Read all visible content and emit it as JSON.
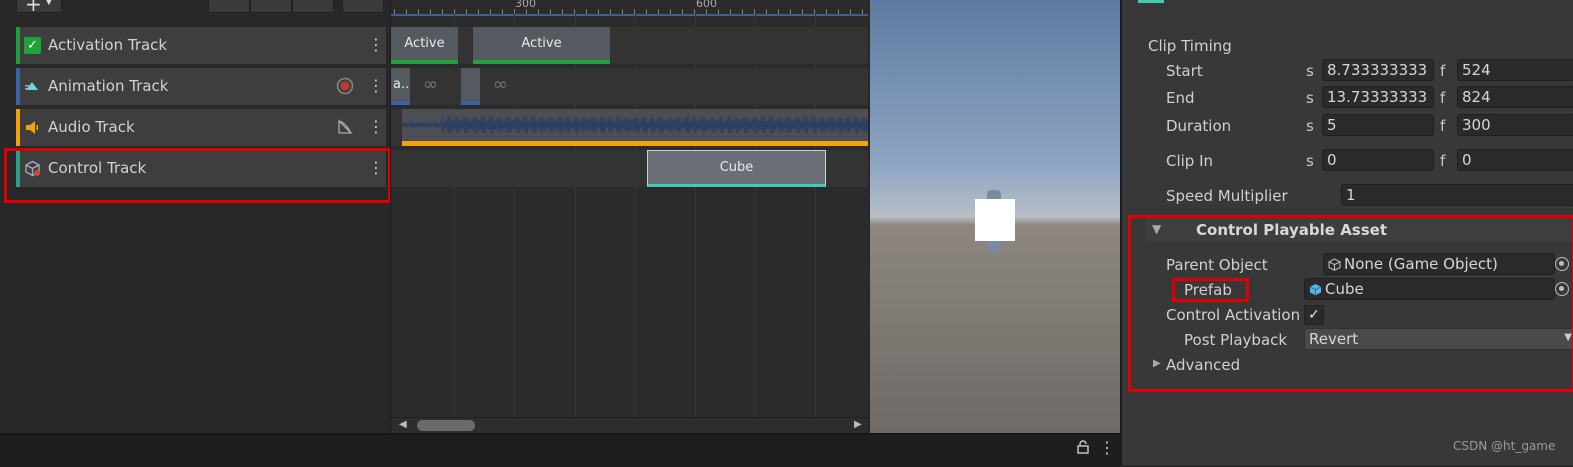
{
  "timeline": {
    "tracks": [
      {
        "label": "Activation Track",
        "color": "#1e9e3a",
        "icon": "activation-checkbox-icon"
      },
      {
        "label": "Animation Track",
        "color": "#3a62a8",
        "icon": "animation-track-icon"
      },
      {
        "label": "Audio Track",
        "color": "#f0a30a",
        "icon": "speaker-icon"
      },
      {
        "label": "Control Track",
        "color": "#28a08a",
        "icon": "control-cube-icon"
      }
    ],
    "ruler_labels": [
      "300",
      "600"
    ],
    "activation_clips": [
      "Active",
      "Active"
    ],
    "animation_clip_label": "a..",
    "control_clip_label": "Cube",
    "menu_glyph": "⋮"
  },
  "inspector": {
    "clip_timing": {
      "title": "Clip Timing",
      "start": {
        "label": "Start",
        "s_unit": "s",
        "seconds": "8.733333333",
        "f_unit": "f",
        "frames": "524"
      },
      "end": {
        "label": "End",
        "s_unit": "s",
        "seconds": "13.73333333",
        "f_unit": "f",
        "frames": "824"
      },
      "duration": {
        "label": "Duration",
        "s_unit": "s",
        "seconds": "5",
        "f_unit": "f",
        "frames": "300"
      },
      "clip_in": {
        "label": "Clip In",
        "s_unit": "s",
        "seconds": "0",
        "f_unit": "f",
        "frames": "0"
      },
      "speed_multiplier": {
        "label": "Speed Multiplier",
        "value": "1"
      }
    },
    "control_asset": {
      "title": "Control Playable Asset",
      "parent_object": {
        "label": "Parent Object",
        "value": "None (Game Object)"
      },
      "prefab": {
        "label": "Prefab",
        "value": "Cube"
      },
      "control_activation": {
        "label": "Control Activation",
        "checked": true
      },
      "post_playback": {
        "label": "Post Playback",
        "value": "Revert"
      },
      "advanced": {
        "label": "Advanced"
      }
    }
  },
  "watermark": "CSDN @ht_game",
  "colors": {
    "highlight": "#e00000",
    "accent_teal": "#46c8b4"
  }
}
